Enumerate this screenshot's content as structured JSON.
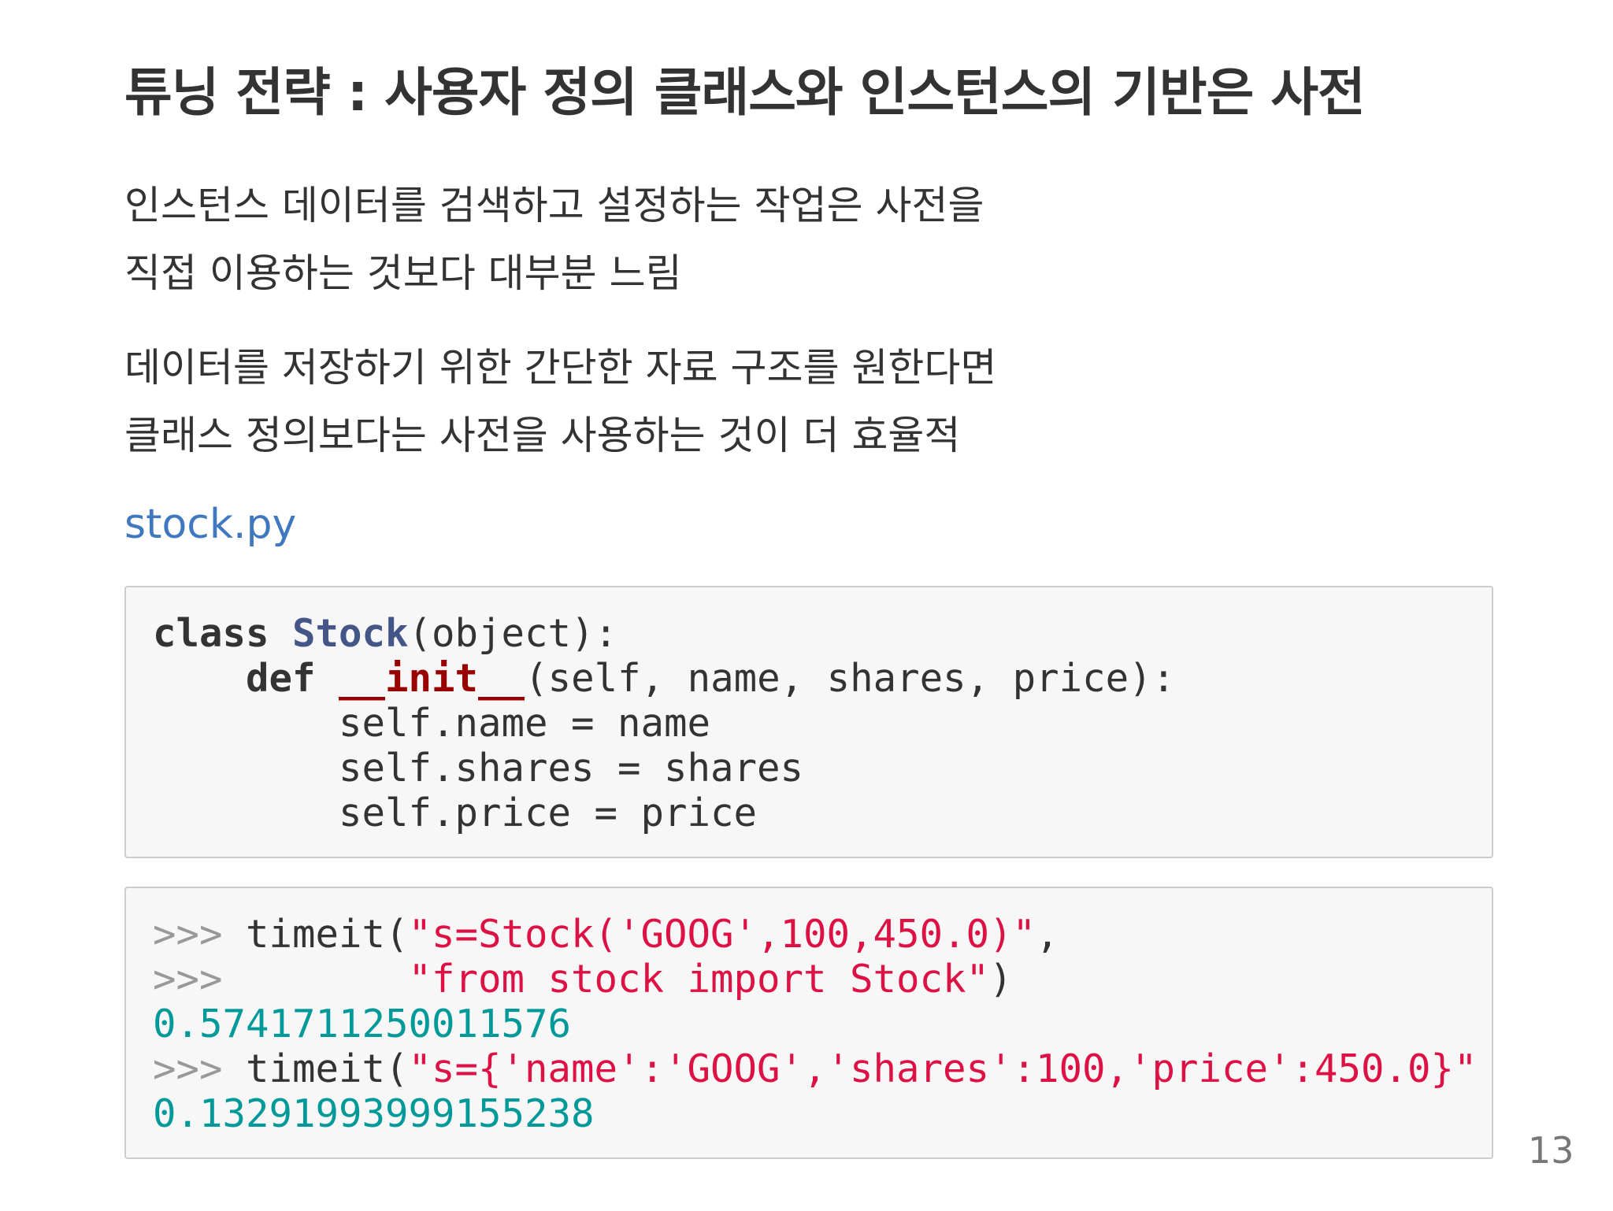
{
  "slide": {
    "title": "튜닝 전략 : 사용자 정의 클래스와 인스턴스의 기반은 사전",
    "paragraphs": [
      {
        "lines": [
          "인스턴스 데이터를 검색하고 설정하는 작업은 사전을",
          "직접 이용하는 것보다 대부분 느림"
        ]
      },
      {
        "lines": [
          "데이터를 저장하기 위한 간단한 자료 구조를 원한다면",
          "클래스 정의보다는 사전을 사용하는 것이 더 효율적"
        ]
      }
    ],
    "file_link": "stock.py",
    "page_number": "13"
  },
  "code_blocks": [
    {
      "language": "python",
      "lines": [
        "class Stock(object):",
        "    def __init__(self, name, shares, price):",
        "        self.name = name",
        "        self.shares = shares",
        "        self.price = price"
      ],
      "tokens": {
        "l0_kw": "class",
        "l0_sp": " ",
        "l0_cls": "Stock",
        "l0_rest": "(object):",
        "l1_indent": "    ",
        "l1_kw": "def",
        "l1_sp": " ",
        "l1_fn": "__init__",
        "l1_rest": "(self, name, shares, price):",
        "l2": "        self.name = name",
        "l3": "        self.shares = shares",
        "l4": "        self.price = price"
      }
    },
    {
      "language": "python-console",
      "lines": [
        ">>> timeit(\"s=Stock('GOOG',100,450.0)\",",
        ">>>        \"from stock import Stock\")",
        "0.5741711250011576",
        ">>> timeit(\"s={'name':'GOOG','shares':100,'price':450.0}\"",
        "0.13291993999155238"
      ],
      "tokens": {
        "l0_prompt": ">>>",
        "l0_code": " timeit(",
        "l0_str": "\"s=Stock('GOOG',100,450.0)\"",
        "l0_tail": ",",
        "l1_prompt": ">>>",
        "l1_indent": "        ",
        "l1_str": "\"from stock import Stock\"",
        "l1_tail": ")",
        "l2_num": "0.5741711250011576",
        "l3_prompt": ">>>",
        "l3_code": " timeit(",
        "l3_str": "\"s={'name':'GOOG','shares':100,'price':450.0}\"",
        "l4_num": "0.13291993999155238"
      }
    }
  ]
}
